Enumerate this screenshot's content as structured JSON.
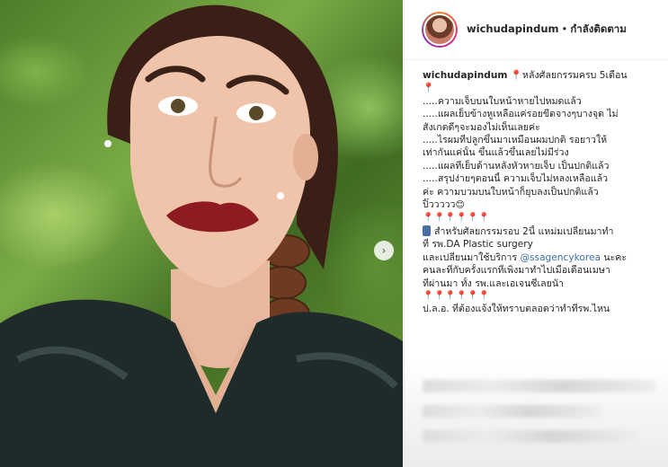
{
  "header": {
    "username": "wichudapindum",
    "separator": "•",
    "follow_status": "กำลังติดตาม"
  },
  "photo": {
    "next_icon": "chevron-right-icon",
    "next_glyph": "›"
  },
  "caption": {
    "username": "wichudapindum",
    "title_line": "หลังศัลยกรรมครบ 5เดือน",
    "lines": [
      ".....ความเจ็บบนใบหน้าหายไปหมดแล้ว",
      ".....แผลเย็บข้างหูเหลือแค่รอยขีดจางๆบางจุด ไม่",
      "สังเกตดีๆจะมองไม่เห็นเลยค่ะ",
      ".....ไรผมที่ปลูกขึ้นมาเหมือนผมปกติ รอยาวให้",
      "เท่ากันแค่นั้น ขึ้นแล้วขึ้นเลยไม่มีร่วง",
      ".....แผลที่เย็บด้านหลังหัวหายเจ็บ เป็นปกติแล้ว",
      ".....สรุปง่ายๆตอนนี้ ความเจ็บไม่หลงเหลือแล้ว",
      "ค่ะ ความบวมบนใบหน้าก็ยุบลงเป็นปกติแล้ว",
      "ปิ๊ววววว"
    ],
    "pin_row": "📍📍📍📍📍📍",
    "surgery_line_1": "สำหรับศัลยกรรมรอบ 2นี้ แหม่มเปลี่ยนมาทำ",
    "surgery_line_2": "ที่ รพ.DA Plastic surgery",
    "agency_line_prefix": "และเปลี่ยนมาใช้บริการ ",
    "agency_mention": "@ssagencykorea",
    "agency_line_suffix": " นะคะ",
    "agency_line_2": "คนละที่กับครั้งแรกที่เพิ่งมาทำไปเมื่อเดือนเมษา",
    "agency_line_3": "ที่ผ่านมา ทั้ง รพ.และเอเจนซี่เลยนัา",
    "pin_row_2": "📍📍📍📍📍📍",
    "last_line": "ป.ล.อ. ที่ต้องแจ้งให้ทราบตลอดว่าทำที่รพ.ไหน",
    "smiley": "😊"
  },
  "colors": {
    "accent_link": "#3b6ea5",
    "pin_red": "#c0392b"
  }
}
